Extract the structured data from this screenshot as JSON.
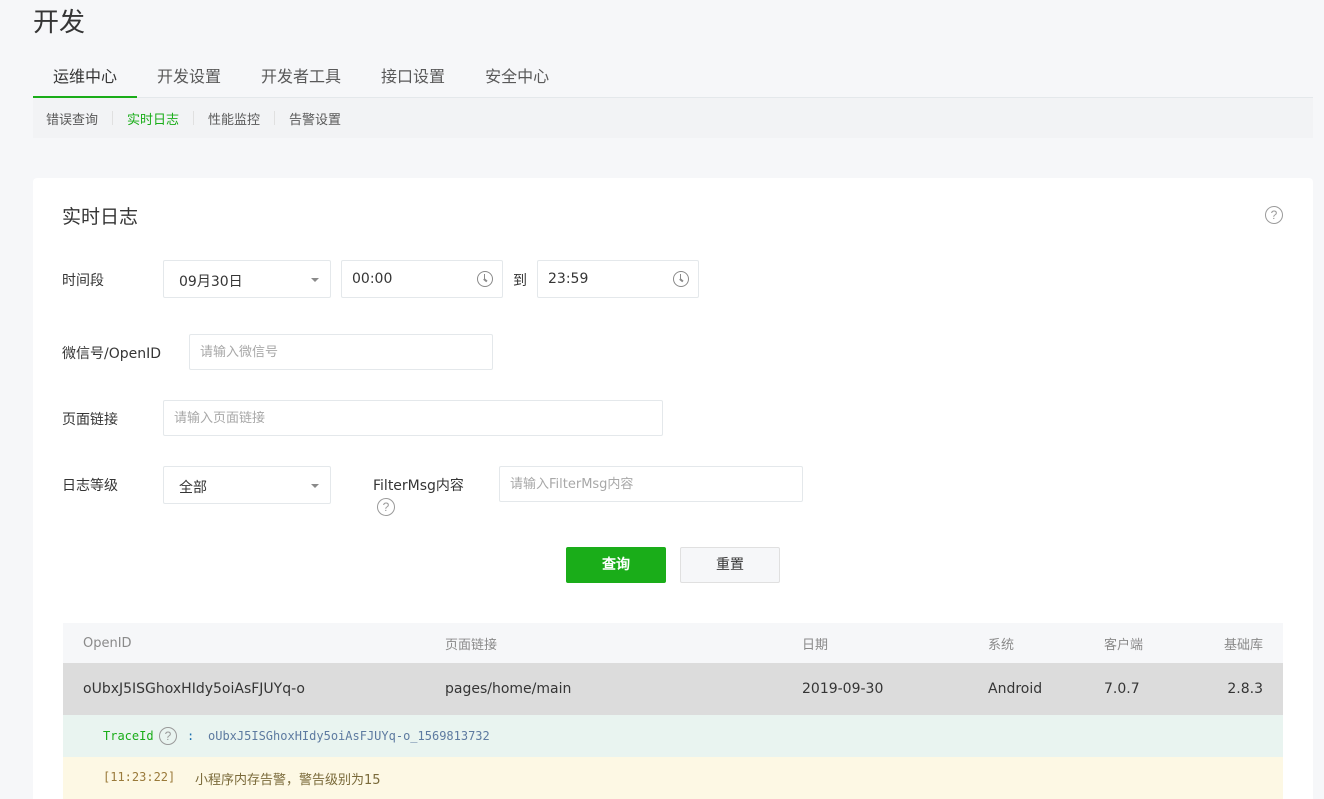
{
  "page_title": "开发",
  "main_tabs": [
    {
      "label": "运维中心",
      "active": true
    },
    {
      "label": "开发设置",
      "active": false
    },
    {
      "label": "开发者工具",
      "active": false
    },
    {
      "label": "接口设置",
      "active": false
    },
    {
      "label": "安全中心",
      "active": false
    }
  ],
  "sub_tabs": [
    {
      "label": "错误查询",
      "active": false
    },
    {
      "label": "实时日志",
      "active": true
    },
    {
      "label": "性能监控",
      "active": false
    },
    {
      "label": "告警设置",
      "active": false
    }
  ],
  "card": {
    "title": "实时日志",
    "help_glyph": "?"
  },
  "form": {
    "time_range": {
      "label": "时间段",
      "date": "09月30日",
      "start_time": "00:00",
      "to_label": "到",
      "end_time": "23:59"
    },
    "openid": {
      "label": "微信号/OpenID",
      "placeholder": "请输入微信号"
    },
    "page_link": {
      "label": "页面链接",
      "placeholder": "请输入页面链接"
    },
    "log_level": {
      "label": "日志等级",
      "value": "全部"
    },
    "filter_msg": {
      "label": "FilterMsg内容",
      "placeholder": "请输入FilterMsg内容"
    },
    "query_label": "查询",
    "reset_label": "重置"
  },
  "table": {
    "headers": {
      "openid": "OpenID",
      "page": "页面链接",
      "date": "日期",
      "system": "系统",
      "client": "客户端",
      "lib": "基础库"
    },
    "rows": [
      {
        "openid": "oUbxJ5ISGhoxHIdy5oiAsFJUYq-o",
        "page": "pages/home/main",
        "date": "2019-09-30",
        "system": "Android",
        "client": "7.0.7",
        "lib": "2.8.3"
      }
    ],
    "trace": {
      "key": "TraceId",
      "colon": ":",
      "value": "oUbxJ5ISGhoxHIdy5oiAsFJUYq-o_1569813732"
    },
    "log": {
      "time": "[11:23:22]",
      "message": "小程序内存告警，警告级别为15"
    }
  },
  "colors": {
    "accent": "#1aad19",
    "row_selected_bg": "#dcdcdc",
    "trace_bg": "#e9f4f0",
    "log_bg": "#fdf8e4"
  }
}
